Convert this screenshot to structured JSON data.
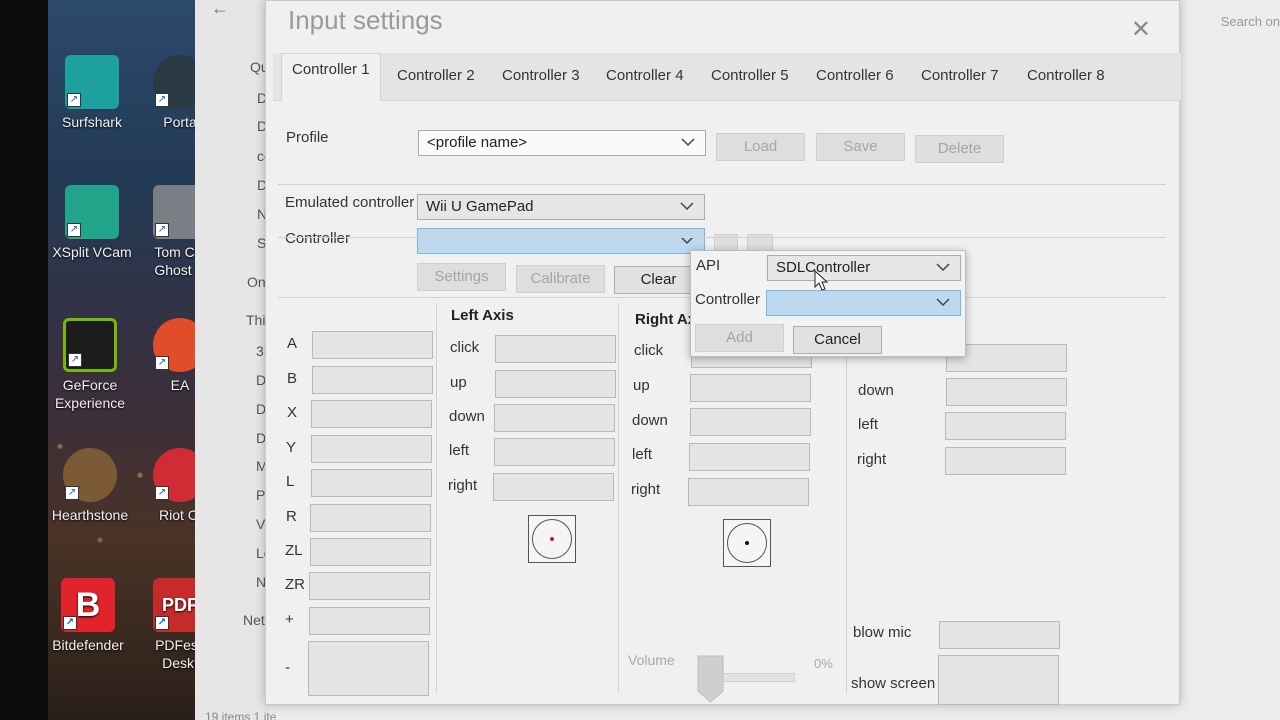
{
  "desktop": {
    "icons": [
      {
        "label": "Surfshark",
        "icon": "surfshark-icon",
        "color": "#1ea0a0"
      },
      {
        "label": "Porta",
        "icon": "portal-icon",
        "color": "#2a3a44"
      },
      {
        "label": "XSplit VCam",
        "icon": "xsplit-vcam-icon",
        "color": "#23a58c"
      },
      {
        "label": "Tom Cla Ghost R",
        "icon": "tom-clancy-ghost-recon-icon",
        "color": "#7a7f86"
      },
      {
        "label": "GeForce Experience",
        "icon": "geforce-experience-icon",
        "color": "#76b900"
      },
      {
        "label": "EA",
        "icon": "ea-icon",
        "color": "#e14d2a"
      },
      {
        "label": "Hearthstone",
        "icon": "hearthstone-icon",
        "color": "#7b5a35"
      },
      {
        "label": "Riot Cl",
        "icon": "riot-client-icon",
        "color": "#d12c36"
      },
      {
        "label": "Bitdefender",
        "icon": "bitdefender-icon",
        "color": "#e2232c"
      },
      {
        "label": "PDFesc Deskt",
        "icon": "pdfescape-icon",
        "color": "#c62b2b"
      }
    ]
  },
  "explorer": {
    "nav": [
      "Qui",
      "D",
      "D",
      "cc",
      "D",
      "N",
      "Sc",
      "One",
      "This",
      "3D",
      "D",
      "D",
      "D",
      "M",
      "Pi",
      "Vi",
      "Lo",
      "N",
      "Net"
    ],
    "search_text": "Search on",
    "status": "19 items   1 ite"
  },
  "dialog": {
    "title": "Input settings",
    "close_glyph": "✕",
    "tabs": [
      "Controller 1",
      "Controller 2",
      "Controller 3",
      "Controller 4",
      "Controller 5",
      "Controller 6",
      "Controller 7",
      "Controller 8"
    ],
    "active_tab": 0,
    "profile": {
      "label": "Profile",
      "value": "<profile name>",
      "load": "Load",
      "save": "Save",
      "delete": "Delete"
    },
    "emulated": {
      "label": "Emulated controller",
      "value": "Wii U GamePad"
    },
    "controller": {
      "label": "Controller",
      "value": "",
      "settings": "Settings",
      "calibrate": "Calibrate",
      "clear": "Clear"
    },
    "buttons": {
      "labels": [
        "A",
        "B",
        "X",
        "Y",
        "L",
        "R",
        "ZL",
        "ZR",
        "+",
        "-"
      ]
    },
    "left_axis": {
      "title": "Left Axis",
      "labels": [
        "click",
        "up",
        "down",
        "left",
        "right"
      ],
      "dot_color": "#d81b1b"
    },
    "right_axis": {
      "title": "Right Ax",
      "labels": [
        "click",
        "up",
        "down",
        "left",
        "right"
      ],
      "dot_color": "#111111"
    },
    "dpad": {
      "labels": [
        "up",
        "down",
        "left",
        "right"
      ]
    },
    "extras": {
      "blow_mic": "blow mic",
      "show_screen": "show screen"
    },
    "volume": {
      "label": "Volume",
      "value_text": "0%",
      "value": 0
    }
  },
  "popup": {
    "api_label": "API",
    "api_value": "SDLController",
    "controller_label": "Controller",
    "controller_value": "",
    "add": "Add",
    "cancel": "Cancel"
  }
}
